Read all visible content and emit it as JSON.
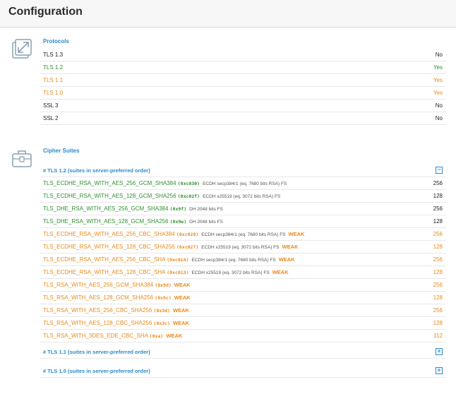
{
  "page": {
    "title": "Configuration"
  },
  "protocols": {
    "title": "Protocols",
    "icon": "resize-arrows-icon",
    "rows": [
      {
        "label": "TLS 1.3",
        "value": "No",
        "color": "black"
      },
      {
        "label": "TLS 1.2",
        "value": "Yes",
        "color": "green"
      },
      {
        "label": "TLS 1.1",
        "value": "Yes",
        "color": "orange"
      },
      {
        "label": "TLS 1.0",
        "value": "Yes",
        "color": "orange"
      },
      {
        "label": "SSL 3",
        "value": "No",
        "color": "black"
      },
      {
        "label": "SSL 2",
        "value": "No",
        "color": "black"
      }
    ]
  },
  "cipher_suites": {
    "title": "Cipher Suites",
    "icon": "toolbox-icon",
    "groups": [
      {
        "label": "# TLS 1.2 (suites in server-preferred order)",
        "toggle": "−",
        "expanded": true
      },
      {
        "label": "# TLS 1.1 (suites in server-preferred order)",
        "toggle": "+",
        "expanded": false
      },
      {
        "label": "# TLS 1.0 (suites in server-preferred order)",
        "toggle": "+",
        "expanded": false
      }
    ],
    "tls12_suites": [
      {
        "name": "TLS_ECDHE_RSA_WITH_AES_256_GCM_SHA384",
        "code": "(0xc030)",
        "meta": "ECDH secp384r1 (eq. 7680 bits RSA)   FS",
        "weak": "",
        "bits": "256",
        "color": "green"
      },
      {
        "name": "TLS_ECDHE_RSA_WITH_AES_128_GCM_SHA256",
        "code": "(0xc02f)",
        "meta": "ECDH x25519 (eq. 3072 bits RSA)   FS",
        "weak": "",
        "bits": "128",
        "color": "green"
      },
      {
        "name": "TLS_DHE_RSA_WITH_AES_256_GCM_SHA384",
        "code": "(0x9f)",
        "meta": "DH 2048 bits   FS",
        "weak": "",
        "bits": "256",
        "color": "green"
      },
      {
        "name": "TLS_DHE_RSA_WITH_AES_128_GCM_SHA256",
        "code": "(0x9e)",
        "meta": "DH 2048 bits   FS",
        "weak": "",
        "bits": "128",
        "color": "green"
      },
      {
        "name": "TLS_ECDHE_RSA_WITH_AES_256_CBC_SHA384",
        "code": "(0xc028)",
        "meta": "ECDH secp384r1 (eq. 7680 bits RSA)   FS",
        "weak": "WEAK",
        "bits": "256",
        "color": "orange"
      },
      {
        "name": "TLS_ECDHE_RSA_WITH_AES_128_CBC_SHA256",
        "code": "(0xc027)",
        "meta": "ECDH x25519 (eq. 3072 bits RSA)   FS",
        "weak": "WEAK",
        "bits": "128",
        "color": "orange"
      },
      {
        "name": "TLS_ECDHE_RSA_WITH_AES_256_CBC_SHA",
        "code": "(0xc014)",
        "meta": "ECDH secp384r1 (eq. 7680 bits RSA)   FS",
        "weak": "WEAK",
        "bits": "256",
        "color": "orange"
      },
      {
        "name": "TLS_ECDHE_RSA_WITH_AES_128_CBC_SHA",
        "code": "(0xc013)",
        "meta": "ECDH x25519 (eq. 3072 bits RSA)   FS",
        "weak": "WEAK",
        "bits": "128",
        "color": "orange"
      },
      {
        "name": "TLS_RSA_WITH_AES_256_GCM_SHA384",
        "code": "(0x9d)",
        "meta": "",
        "weak": "WEAK",
        "bits": "256",
        "color": "orange"
      },
      {
        "name": "TLS_RSA_WITH_AES_128_GCM_SHA256",
        "code": "(0x9c)",
        "meta": "",
        "weak": "WEAK",
        "bits": "128",
        "color": "orange"
      },
      {
        "name": "TLS_RSA_WITH_AES_256_CBC_SHA256",
        "code": "(0x3d)",
        "meta": "",
        "weak": "WEAK",
        "bits": "256",
        "color": "orange"
      },
      {
        "name": "TLS_RSA_WITH_AES_128_CBC_SHA256",
        "code": "(0x3c)",
        "meta": "",
        "weak": "WEAK",
        "bits": "128",
        "color": "orange"
      },
      {
        "name": "TLS_RSA_WITH_3DES_EDE_CBC_SHA",
        "code": "(0xa)",
        "meta": "",
        "weak": "WEAK",
        "bits": "112",
        "color": "orange"
      }
    ]
  },
  "colors": {
    "green": "#2f8f2f",
    "orange": "#e88a1a",
    "accent": "#2a8bc8",
    "text": "#222222"
  }
}
